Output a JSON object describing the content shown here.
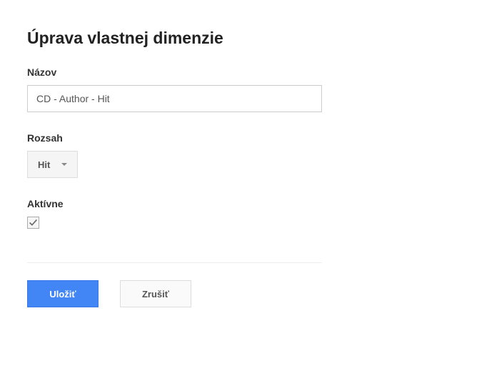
{
  "page": {
    "title": "Úprava vlastnej dimenzie"
  },
  "fields": {
    "name": {
      "label": "Názov",
      "value": "CD - Author - Hit"
    },
    "scope": {
      "label": "Rozsah",
      "selected": "Hit"
    },
    "active": {
      "label": "Aktívne",
      "checked": true
    }
  },
  "buttons": {
    "save": "Uložiť",
    "cancel": "Zrušiť"
  }
}
